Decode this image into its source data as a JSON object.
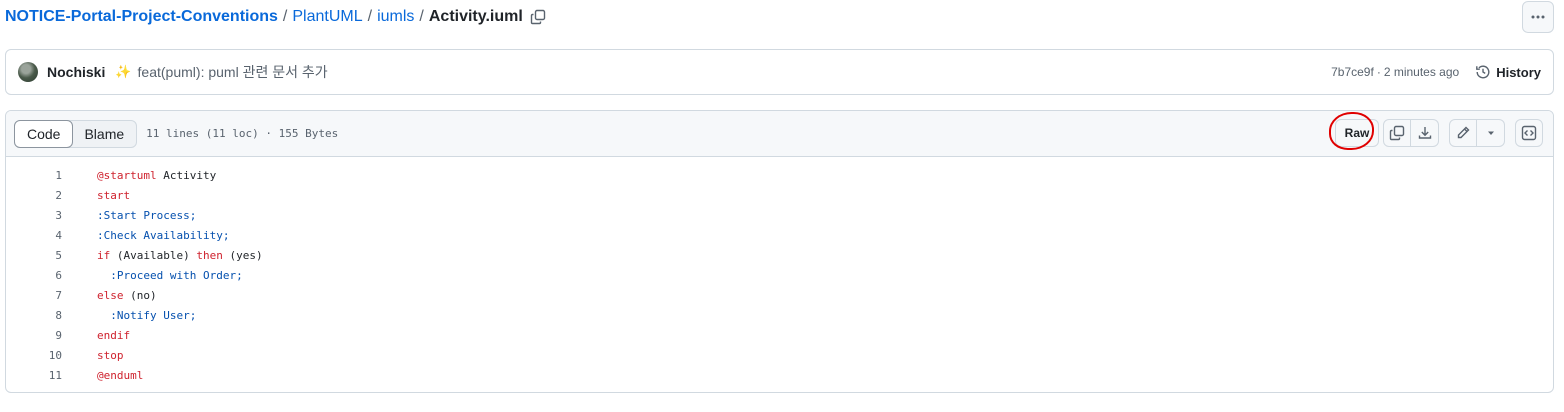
{
  "breadcrumb": {
    "repo": "NOTICE-Portal-Project-Conventions",
    "folder1": "PlantUML",
    "folder2": "iumls",
    "file": "Activity.iuml",
    "separator": "/"
  },
  "commit": {
    "author": "Nochiski",
    "emoji": "✨",
    "message": "feat(puml): puml 관련 문서 추가",
    "sha": "7b7ce9f",
    "dot": "·",
    "time": "2 minutes ago",
    "history_label": "History"
  },
  "file_header": {
    "tab_code": "Code",
    "tab_blame": "Blame",
    "meta": "11 lines (11 loc) · 155 Bytes",
    "raw_label": "Raw"
  },
  "icons": {
    "copy_path": "copy-icon",
    "more": "kebab-horizontal-icon",
    "history": "history-icon",
    "copy_raw": "copy-icon",
    "download": "download-icon",
    "edit": "pencil-icon",
    "edit_dropdown": "triangle-down-icon",
    "symbols": "code-square-icon"
  },
  "colors": {
    "link": "#0969da",
    "keyword": "#cf222e",
    "activity": "#0550ae",
    "highlight_circle": "#e00000"
  },
  "code_lines": [
    {
      "num": "1",
      "parts": [
        {
          "t": "@startuml",
          "c": "kw"
        },
        {
          "t": " Activity",
          "c": ""
        }
      ]
    },
    {
      "num": "2",
      "parts": [
        {
          "t": "start",
          "c": "kw"
        }
      ]
    },
    {
      "num": "3",
      "parts": [
        {
          "t": ":Start Process;",
          "c": "act"
        }
      ]
    },
    {
      "num": "4",
      "parts": [
        {
          "t": ":Check Availability;",
          "c": "act"
        }
      ]
    },
    {
      "num": "5",
      "parts": [
        {
          "t": "if",
          "c": "kw"
        },
        {
          "t": " (Available) ",
          "c": ""
        },
        {
          "t": "then",
          "c": "kw"
        },
        {
          "t": " (yes)",
          "c": ""
        }
      ]
    },
    {
      "num": "6",
      "parts": [
        {
          "t": "  ",
          "c": ""
        },
        {
          "t": ":Proceed with Order;",
          "c": "act"
        }
      ]
    },
    {
      "num": "7",
      "parts": [
        {
          "t": "else",
          "c": "kw"
        },
        {
          "t": " (no)",
          "c": ""
        }
      ]
    },
    {
      "num": "8",
      "parts": [
        {
          "t": "  ",
          "c": ""
        },
        {
          "t": ":Notify User;",
          "c": "act"
        }
      ]
    },
    {
      "num": "9",
      "parts": [
        {
          "t": "endif",
          "c": "kw"
        }
      ]
    },
    {
      "num": "10",
      "parts": [
        {
          "t": "stop",
          "c": "kw"
        }
      ]
    },
    {
      "num": "11",
      "parts": [
        {
          "t": "@enduml",
          "c": "kw"
        }
      ]
    }
  ]
}
